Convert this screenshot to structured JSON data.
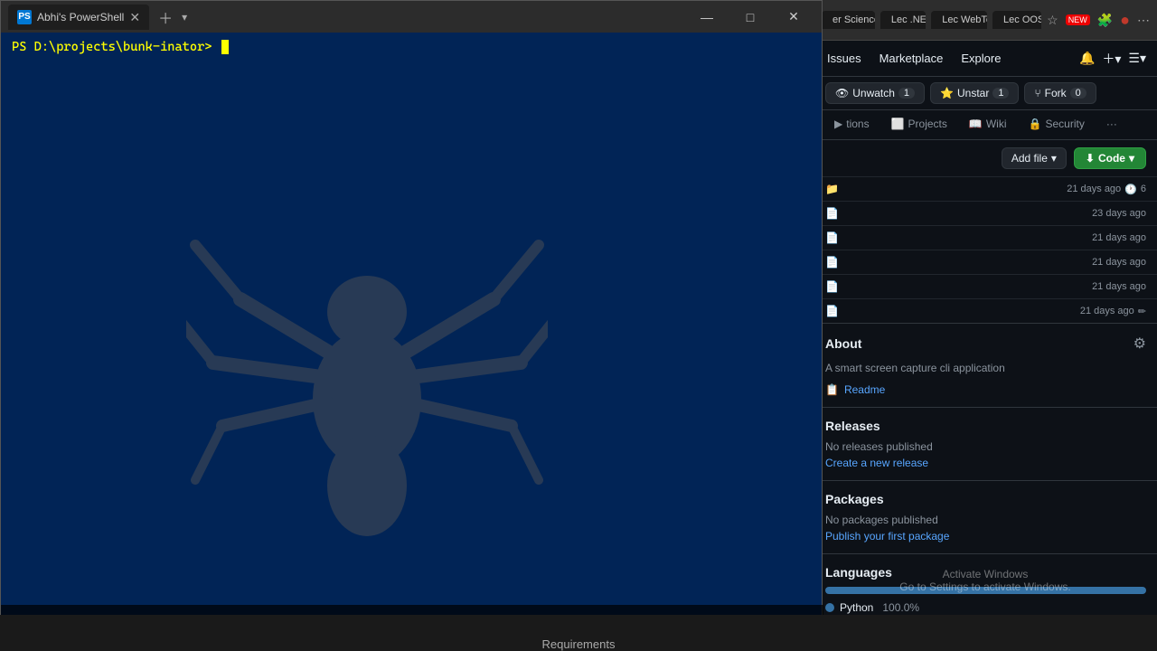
{
  "terminal": {
    "title": "Abhi's PowerShell",
    "prompt": "PS D:\\projects\\bunk-inator> ",
    "tabs": [
      {
        "label": "Abhi's PowerShell",
        "icon": "PS"
      }
    ],
    "window_controls": {
      "minimize": "—",
      "maximize": "□",
      "close": "✕"
    }
  },
  "browser": {
    "tabs": [
      {
        "label": "er Science..."
      },
      {
        "label": "Lec .NET"
      },
      {
        "label": "Lec WebTech"
      },
      {
        "label": "Lec OOSE"
      }
    ],
    "actions": {
      "bookmark": "☆",
      "new_badge": "NEW",
      "extensions": "🧩",
      "profile": "●",
      "more": "⋮"
    }
  },
  "github": {
    "nav": {
      "items": [
        "Issues",
        "Marketplace",
        "Explore"
      ]
    },
    "repo_actions": {
      "unwatch_label": "Unwatch",
      "unwatch_count": "1",
      "star_label": "Unstar",
      "star_count": "1",
      "fork_label": "Fork",
      "fork_count": "0"
    },
    "tabs": [
      {
        "label": "tions",
        "icon": "📋"
      },
      {
        "label": "Projects",
        "icon": "🗂"
      },
      {
        "label": "Wiki",
        "icon": "📖"
      },
      {
        "label": "Security",
        "icon": "🔒"
      },
      {
        "label": "···",
        "icon": ""
      }
    ],
    "file_actions": {
      "add_file": "Add file",
      "code": "Code",
      "code_icon": "⬇"
    },
    "files": [
      {
        "age": "21 days ago",
        "commits": "6"
      },
      {
        "age": "23 days ago"
      },
      {
        "age": "21 days ago"
      },
      {
        "age": "21 days ago"
      },
      {
        "age": "21 days ago"
      },
      {
        "age": "21 days ago"
      }
    ],
    "about": {
      "title": "About",
      "description": "A smart screen capture cli application",
      "readme_label": "Readme"
    },
    "releases": {
      "title": "Releases",
      "no_releases": "No releases published",
      "create_link": "Create a new release"
    },
    "packages": {
      "title": "Packages",
      "no_packages": "No packages published",
      "publish_link": "Publish your first package"
    },
    "languages": {
      "title": "Languages",
      "bar_color": "#3572a5",
      "items": [
        {
          "name": "Python",
          "percent": "100.0%",
          "color": "#3572a5"
        }
      ]
    }
  },
  "watermark": {
    "line1": "Activate Windows",
    "line2": "Go to Settings to activate Windows."
  },
  "bottom_bar": {
    "text": "Requirements"
  }
}
